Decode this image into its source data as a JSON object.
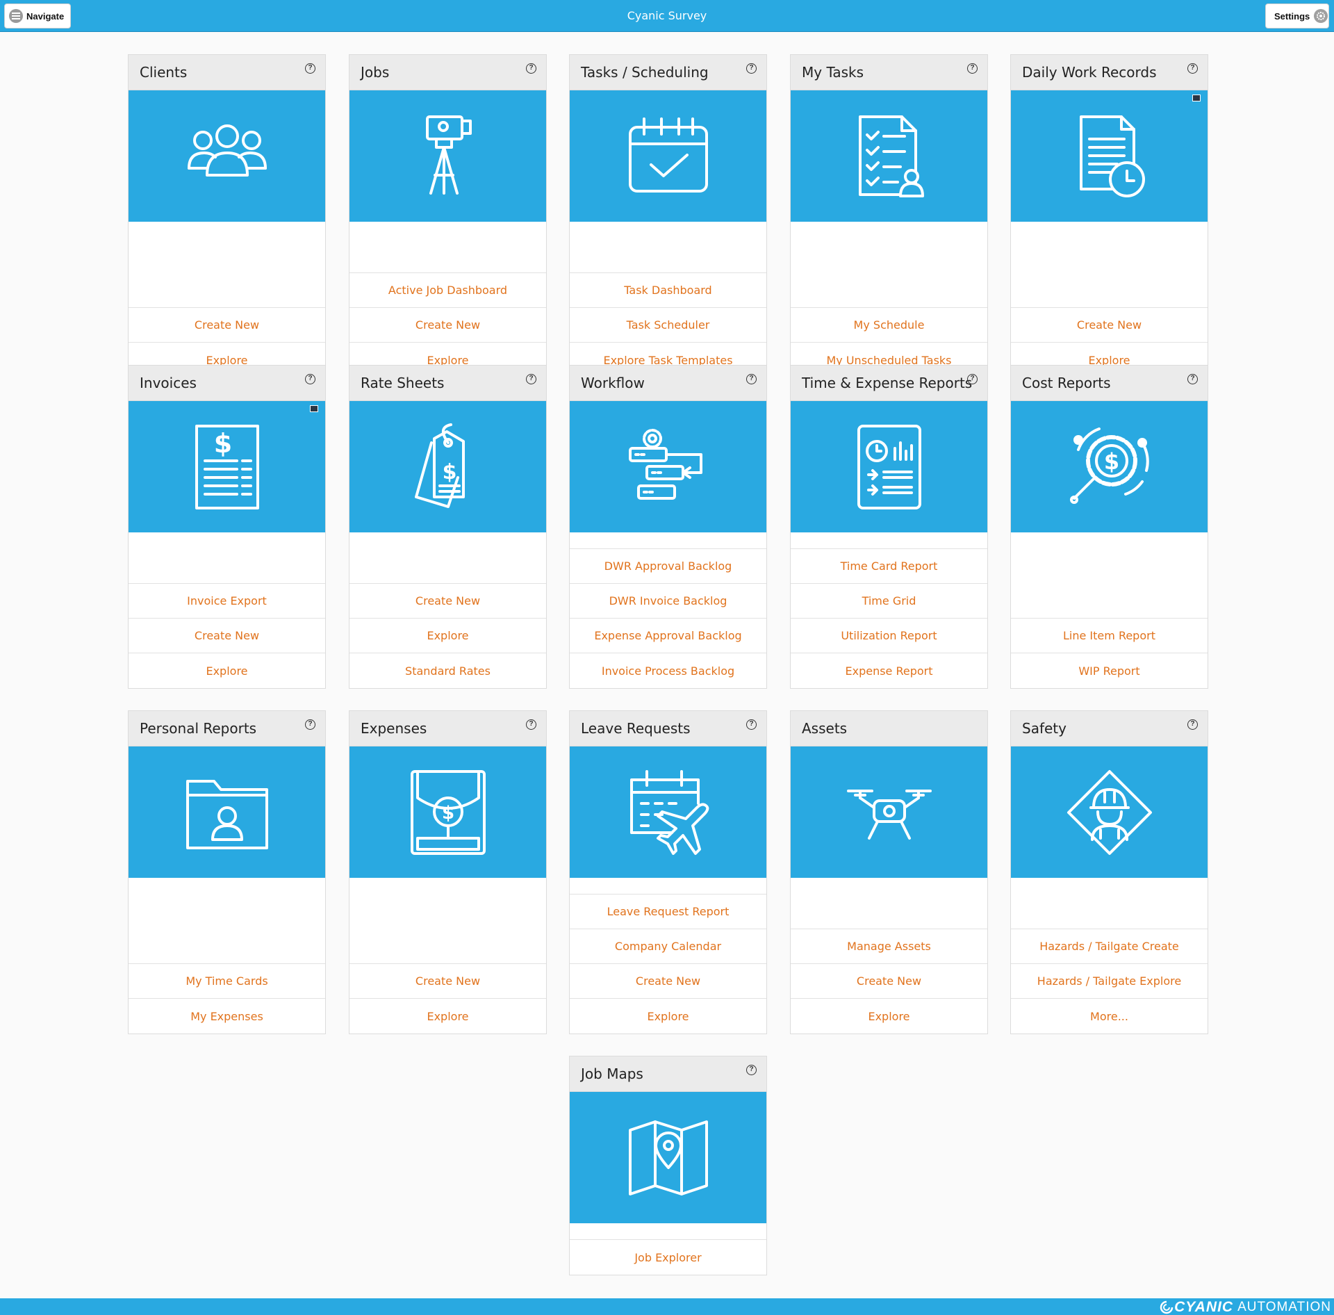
{
  "app": {
    "title": "Cyanic Survey",
    "navigate_label": "Navigate",
    "settings_label": "Settings",
    "footer_brand_bold": "CYANIC",
    "footer_brand_light": "AUTOMATION"
  },
  "colors": {
    "accent": "#29a9e1",
    "link": "#e1731d",
    "header_bg": "#ebebeb"
  },
  "cards": [
    {
      "title": "Clients",
      "icon": "clients-icon",
      "help": true,
      "corner": false,
      "blank_rows": 1,
      "links": [
        "Create New",
        "Explore"
      ]
    },
    {
      "title": "Jobs",
      "icon": "survey-tripod-icon",
      "help": true,
      "corner": false,
      "blank_rows": 0,
      "links": [
        "Active Job Dashboard",
        "Create New",
        "Explore"
      ]
    },
    {
      "title": "Tasks / Scheduling",
      "icon": "calendar-check-icon",
      "help": true,
      "corner": false,
      "blank_rows": 0,
      "links": [
        "Task Dashboard",
        "Task Scheduler",
        "Explore Task Templates"
      ]
    },
    {
      "title": "My Tasks",
      "icon": "task-list-user-icon",
      "help": true,
      "corner": false,
      "blank_rows": 1,
      "links": [
        "My Schedule",
        "My Unscheduled Tasks"
      ]
    },
    {
      "title": "Daily Work Records",
      "icon": "document-clock-icon",
      "help": true,
      "corner": true,
      "blank_rows": 1,
      "links": [
        "Create New",
        "Explore"
      ]
    },
    {
      "title": "Invoices",
      "icon": "invoice-icon",
      "help": true,
      "corner": true,
      "blank_rows": 1,
      "links": [
        "Invoice Export",
        "Create New",
        "Explore"
      ]
    },
    {
      "title": "Rate Sheets",
      "icon": "price-tag-icon",
      "help": true,
      "corner": false,
      "blank_rows": 1,
      "links": [
        "Create New",
        "Explore",
        "Standard Rates"
      ]
    },
    {
      "title": "Workflow",
      "icon": "workflow-icon",
      "help": true,
      "corner": false,
      "blank_rows": 0,
      "links": [
        "DWR Approval Backlog",
        "DWR Invoice Backlog",
        "Expense Approval Backlog",
        "Invoice Process Backlog"
      ]
    },
    {
      "title": "Time & Expense Reports",
      "icon": "report-chart-icon",
      "help": true,
      "corner": false,
      "blank_rows": 0,
      "links": [
        "Time Card Report",
        "Time Grid",
        "Utilization Report",
        "Expense Report"
      ]
    },
    {
      "title": "Cost Reports",
      "icon": "cost-gear-search-icon",
      "help": true,
      "corner": false,
      "blank_rows": 2,
      "links": [
        "Line Item Report",
        "WIP Report"
      ]
    },
    {
      "title": "Personal Reports",
      "icon": "folder-user-icon",
      "help": true,
      "corner": false,
      "blank_rows": 2,
      "links": [
        "My Time Cards",
        "My Expenses"
      ]
    },
    {
      "title": "Expenses",
      "icon": "expense-envelope-icon",
      "help": true,
      "corner": false,
      "blank_rows": 2,
      "links": [
        "Create New",
        "Explore"
      ]
    },
    {
      "title": "Leave Requests",
      "icon": "calendar-plane-icon",
      "help": true,
      "corner": false,
      "blank_rows": 0,
      "links": [
        "Leave Request Report",
        "Company Calendar",
        "Create New",
        "Explore"
      ]
    },
    {
      "title": "Assets",
      "icon": "drone-icon",
      "help": false,
      "corner": false,
      "blank_rows": 1,
      "links": [
        "Manage Assets",
        "Create New",
        "Explore"
      ]
    },
    {
      "title": "Safety",
      "icon": "safety-worker-icon",
      "help": true,
      "corner": false,
      "blank_rows": 1,
      "links": [
        "Hazards / Tailgate Create",
        "Hazards / Tailgate Explore",
        "More..."
      ]
    },
    {
      "title": "Job Maps",
      "icon": "map-pin-icon",
      "help": true,
      "corner": false,
      "blank_rows": 0,
      "links": [
        "Job Explorer"
      ]
    }
  ]
}
